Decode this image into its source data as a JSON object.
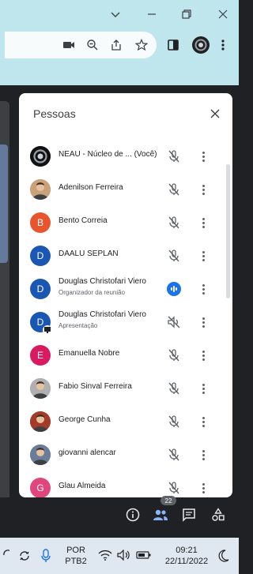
{
  "window_controls": {
    "chevron": "chevron-down-icon",
    "minimize": "minimize-icon",
    "restore": "restore-icon",
    "close": "close-icon"
  },
  "panel": {
    "title": "Pessoas",
    "participants": [
      {
        "name": "NEAU - Núcleo de ... (Você)",
        "subtitle": "",
        "avatar_type": "logo",
        "avatar_letter": "",
        "avatar_color": "#000000",
        "mic": "muted"
      },
      {
        "name": "Adenilson Ferreira",
        "subtitle": "",
        "avatar_type": "photo",
        "avatar_letter": "",
        "avatar_color": "#c9a27a",
        "mic": "muted"
      },
      {
        "name": "Bento Correia",
        "subtitle": "",
        "avatar_type": "letter",
        "avatar_letter": "B",
        "avatar_color": "#e8552d",
        "mic": "muted"
      },
      {
        "name": "DAALU SEPLAN",
        "subtitle": "",
        "avatar_type": "letter",
        "avatar_letter": "D",
        "avatar_color": "#1a57b3",
        "mic": "muted"
      },
      {
        "name": "Douglas Christofari Viero",
        "subtitle": "Organizador da reunião",
        "avatar_type": "letter",
        "avatar_letter": "D",
        "avatar_color": "#1a57b3",
        "mic": "speaking"
      },
      {
        "name": "Douglas Christofari Viero",
        "subtitle": "Apresentação",
        "avatar_type": "letter-presenting",
        "avatar_letter": "D",
        "avatar_color": "#1a57b3",
        "mic": "volume-off"
      },
      {
        "name": "Emanuella Nobre",
        "subtitle": "",
        "avatar_type": "letter",
        "avatar_letter": "E",
        "avatar_color": "#d81b60",
        "mic": "muted"
      },
      {
        "name": "Fabio Sinval Ferreira",
        "subtitle": "",
        "avatar_type": "photo",
        "avatar_letter": "",
        "avatar_color": "#b0b0b0",
        "mic": "muted"
      },
      {
        "name": "George Cunha",
        "subtitle": "",
        "avatar_type": "photo",
        "avatar_letter": "",
        "avatar_color": "#a33a2a",
        "mic": "muted"
      },
      {
        "name": "giovanni alencar",
        "subtitle": "",
        "avatar_type": "photo",
        "avatar_letter": "",
        "avatar_color": "#6a7d99",
        "mic": "muted"
      },
      {
        "name": "Glau Almeida",
        "subtitle": "",
        "avatar_type": "letter",
        "avatar_letter": "G",
        "avatar_color": "#e0457b",
        "mic": "muted"
      }
    ]
  },
  "meet_controls": {
    "people_count": "22"
  },
  "taskbar": {
    "lang_top": "POR",
    "lang_bottom": "PTB2",
    "time": "09:21",
    "date": "22/11/2022"
  }
}
